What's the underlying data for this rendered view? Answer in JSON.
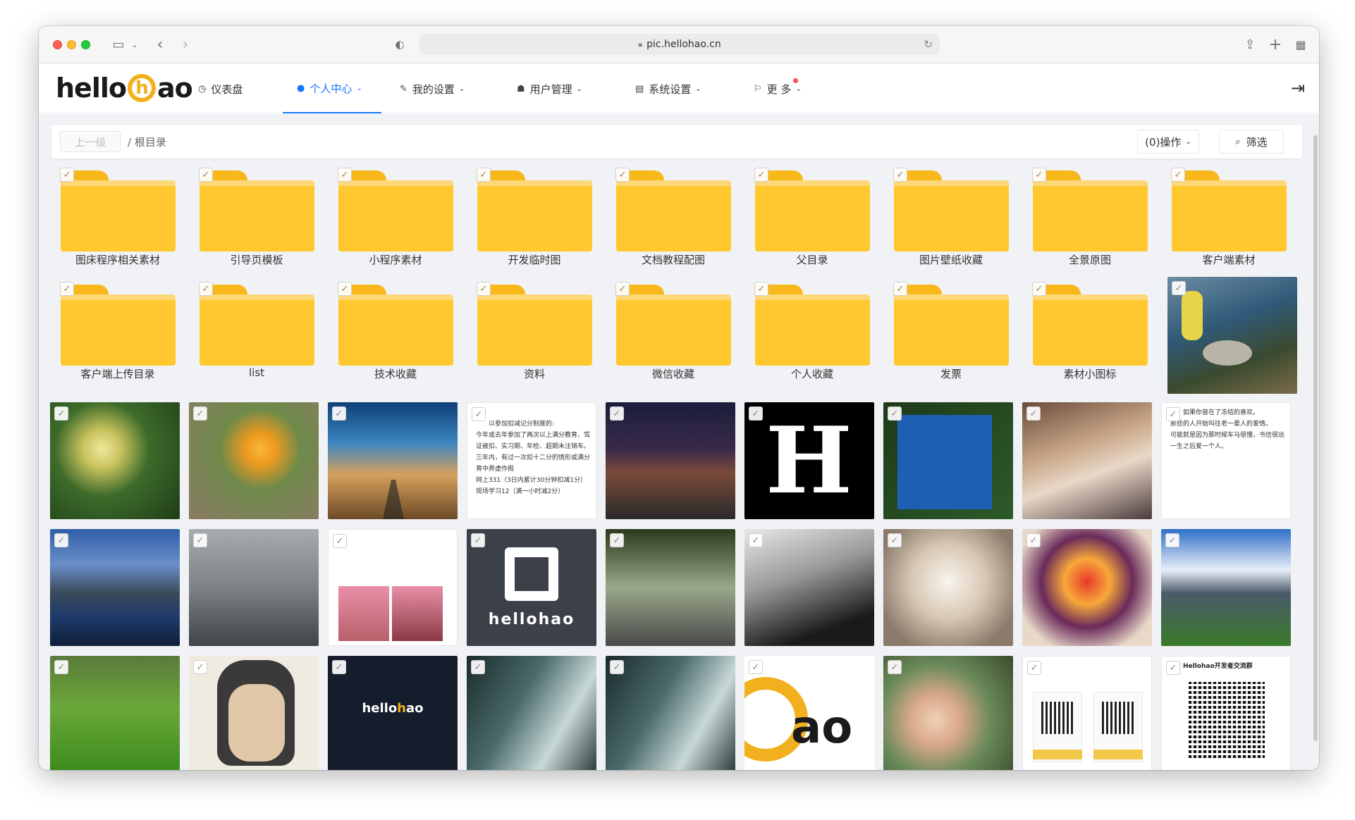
{
  "browser": {
    "url": "pic.hellohao.cn"
  },
  "app": {
    "logo_text_left": "hello",
    "logo_text_h": "h",
    "logo_text_right": "ao",
    "nav": [
      {
        "label": "仪表盘",
        "icon": "dashboard-icon",
        "glyph": "◷"
      },
      {
        "label": "个人中心",
        "icon": "user-circle-icon",
        "glyph": "●",
        "active": true
      },
      {
        "label": "我的设置",
        "icon": "brush-icon",
        "glyph": "✎"
      },
      {
        "label": "用户管理",
        "icon": "users-icon",
        "glyph": "☗"
      },
      {
        "label": "系统设置",
        "icon": "server-icon",
        "glyph": "▤"
      },
      {
        "label": "更 多",
        "icon": "flag-icon",
        "glyph": "⚐"
      }
    ]
  },
  "toolbar": {
    "up_label": "上一级",
    "path_label": "/ 根目录",
    "operate_label": "(0)操作",
    "filter_label": "筛选"
  },
  "folders_row1": [
    "图床程序相关素材",
    "引导页模板",
    "小程序素材",
    "开发临时图",
    "文档教程配图",
    "父目录",
    "图片壁纸收藏",
    "全景原图",
    "客户端素材"
  ],
  "folders_row2": [
    "客户端上传目录",
    "list",
    "技术收藏",
    "资料",
    "微信收藏",
    "个人收藏",
    "发票",
    "素材小图标"
  ],
  "images": {
    "doc1_lines": [
      "以参加扣减记分制度的:",
      "今年或去年参加了两次以上满分教育、驾驶",
      "证被扣、实习期、年检、超期未注销车。",
      "三年内，有过一次扣十二分的情形或满分教",
      "育中弄虚作假",
      "网上331（3日内累计30分钟扣减1分）",
      "现场学习12（满一小时减2分）"
    ],
    "doc2_lines": [
      "如果你曾在了冻结的喜欢。",
      "那些的人开始叫往老一辈人的爱情。",
      "可能就是因为那时候车马很慢，书信很远。",
      "一生之后爱一个人。"
    ],
    "brand_word": "hellohao",
    "qr_title": "Hellohao开发者交流群"
  },
  "colors": {
    "accent": "#1677ff",
    "folder": "#ffc82e",
    "logo": "#f2b01e"
  }
}
